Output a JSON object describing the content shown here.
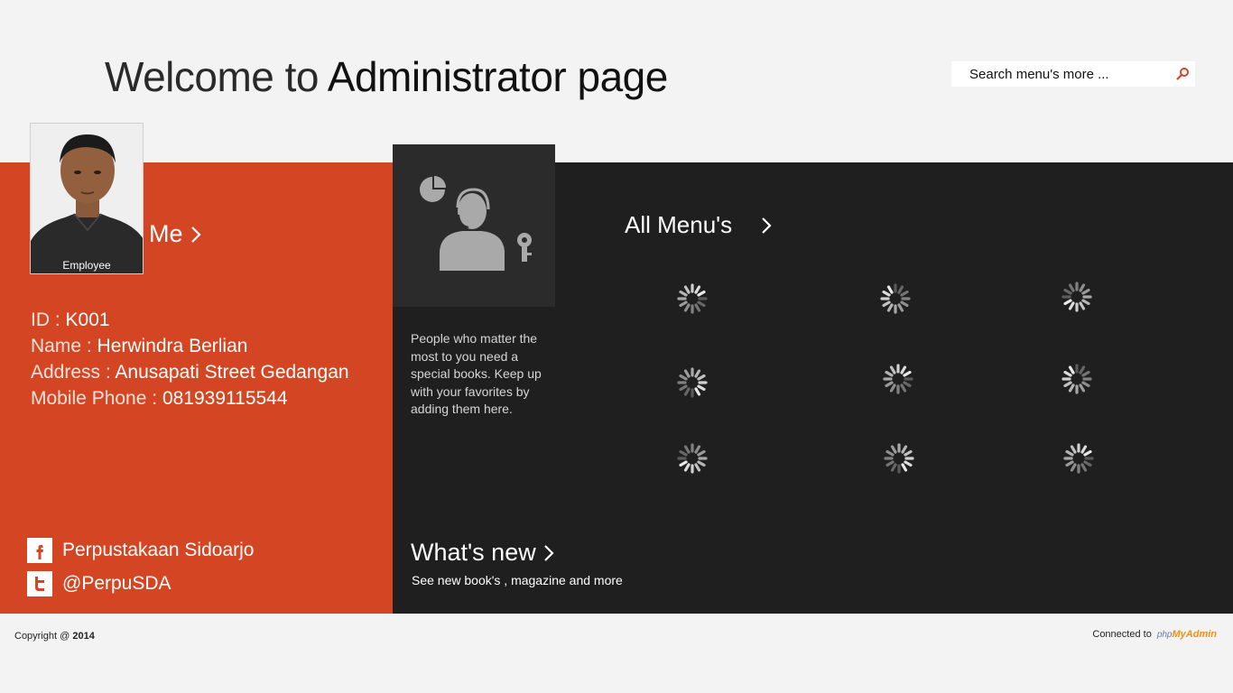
{
  "header": {
    "title_light": "Welcome to ",
    "title_strong": "Administrator page"
  },
  "search": {
    "placeholder": "Search menu's more ...",
    "icon": "search-icon"
  },
  "profile": {
    "photo_caption": "Employee",
    "me_label": "Me",
    "id_label": "ID : ",
    "id_value": "K001",
    "name_label": "Name : ",
    "name_value": "Herwindra Berlian",
    "address_label": "Address : ",
    "address_value": "Anusapati Street Gedangan",
    "phone_label": "Mobile Phone : ",
    "phone_value": "081939115544"
  },
  "social": {
    "facebook": "Perpustakaan Sidoarjo",
    "twitter": "@PerpuSDA"
  },
  "tile": {
    "icon": "user-key-chart-icon",
    "description": "People who matter the most to you need a special books. Keep up with your favorites by adding them here."
  },
  "menus": {
    "all_label": "All Menu's",
    "loading_items": 9
  },
  "whats_new": {
    "title": "What's new",
    "subtitle": "See new book's , magazine and more"
  },
  "footer": {
    "copyright_label": "Copyright @ ",
    "copyright_year": "2014",
    "connected_label": "Connected to",
    "pma_php": "php",
    "pma_my": "MyAdmin"
  },
  "colors": {
    "accent": "#d44623",
    "dark": "#1f1f1f",
    "tile": "#2b2b2b",
    "background": "#f3f3f3"
  }
}
